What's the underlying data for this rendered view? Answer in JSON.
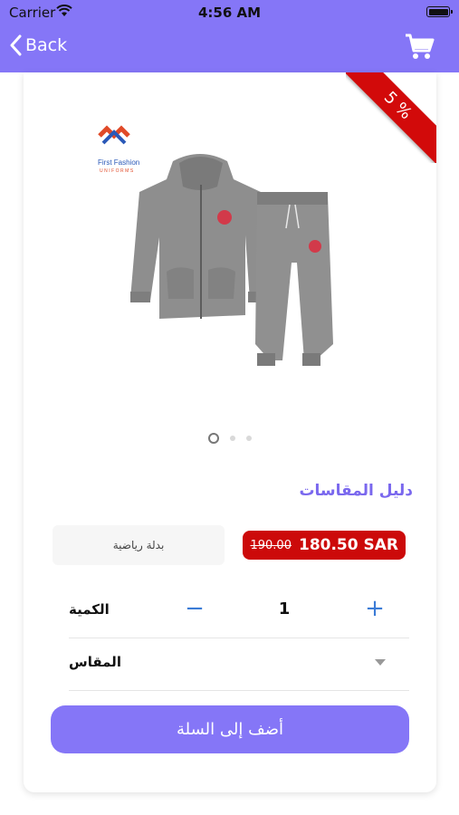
{
  "status_bar": {
    "carrier": "Carrier",
    "time": "4:56 AM"
  },
  "nav": {
    "back_label": "Back",
    "back_icon": "chevron-left-icon",
    "cart_icon": "cart-icon"
  },
  "product": {
    "discount_badge": "5 %",
    "logo_line1": "First Fashion",
    "logo_line2": "UNIFORMS",
    "image_page_count": 3,
    "active_page": 1,
    "size_guide_label": "دليل المقاسات",
    "name": "بدلة رياضية",
    "old_price": "190.00",
    "new_price": "180.50 SAR",
    "quantity_label": "الكمية",
    "quantity_value": "1",
    "size_label": "المقاس",
    "add_to_cart_label": "أضف إلى السلة"
  },
  "colors": {
    "accent": "#8576f7",
    "price_badge": "#cc0a0a",
    "stepper": "#3b7bd6"
  }
}
